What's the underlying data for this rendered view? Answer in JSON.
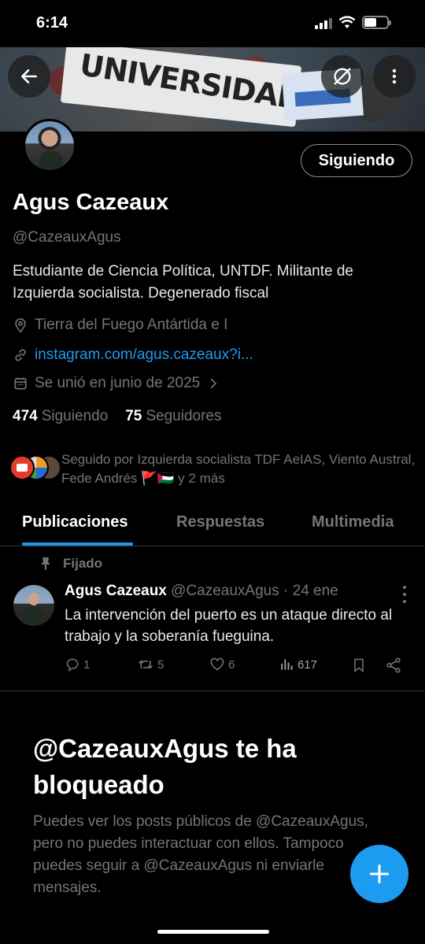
{
  "status_bar": {
    "time": "6:14"
  },
  "banner": {
    "text": "UNIVERSIDAD"
  },
  "profile": {
    "follow_button_label": "Siguiendo",
    "display_name": "Agus Cazeaux",
    "handle": "@CazeauxAgus",
    "bio": "Estudiante de Ciencia Política, UNTDF.  Militante de Izquierda socialista.  Degenerado fiscal",
    "location": "Tierra del Fuego Antártida e I",
    "link": "instagram.com/agus.cazeaux?i...",
    "joined": "Se unió en junio de 2025",
    "following_count": "474",
    "following_label": "Siguiendo",
    "followers_count": "75",
    "followers_label": "Seguidores",
    "followed_by": "Seguido por Izquierda socialista TDF AeIAS, Viento Austral, Fede Andrés 🚩🇵🇸 y 2 más"
  },
  "tabs": [
    {
      "label": "Publicaciones",
      "active": true
    },
    {
      "label": "Respuestas",
      "active": false
    },
    {
      "label": "Multimedia",
      "active": false
    }
  ],
  "pinned_post": {
    "pinned_label": "Fijado",
    "author_name": "Agus Cazeaux",
    "author_meta": "@CazeauxAgus · 24 ene",
    "text": "La intervención del puerto es un ataque directo al trabajo y la soberanía fueguina.",
    "replies": "1",
    "reposts": "5",
    "likes": "6",
    "views": "617"
  },
  "blocked_notice": {
    "title": "@CazeauxAgus te ha bloqueado",
    "body": "Puedes ver los posts públicos de @CazeauxAgus, pero no puedes interactuar con ellos. Tampoco puedes seguir a @CazeauxAgus ni enviarle mensajes."
  },
  "colors": {
    "accent": "#1d9bf0",
    "background": "#000000",
    "muted": "#71767b"
  },
  "icons": [
    "back-arrow-icon",
    "unfollow-swap-icon",
    "more-vertical-icon",
    "location-pin-icon",
    "link-icon",
    "calendar-icon",
    "chevron-right-icon",
    "pin-icon",
    "reply-icon",
    "repost-icon",
    "like-icon",
    "views-icon",
    "bookmark-icon",
    "share-icon",
    "plus-icon"
  ]
}
